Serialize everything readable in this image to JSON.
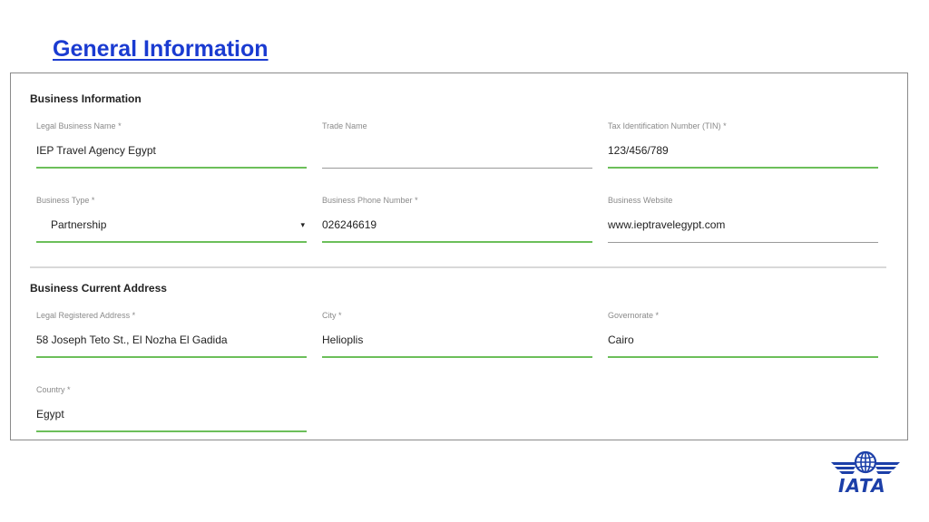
{
  "page": {
    "title": "General Information"
  },
  "business_info": {
    "title": "Business Information",
    "fields": {
      "legal_name": {
        "label": "Legal Business Name",
        "required": "*",
        "value": "IEP Travel Agency Egypt"
      },
      "trade_name": {
        "label": "Trade Name",
        "value": ""
      },
      "tin": {
        "label": "Tax Identification Number (TIN)",
        "required": "*",
        "value": "123/456/789"
      },
      "business_type": {
        "label": "Business Type",
        "required": "*",
        "value": "Partnership",
        "caret": "▾"
      },
      "phone": {
        "label": "Business Phone Number",
        "required": "*",
        "value": "026246619"
      },
      "website": {
        "label": "Business Website",
        "value": "www.ieptravelegypt.com"
      }
    }
  },
  "address": {
    "title": "Business Current Address",
    "fields": {
      "legal_address": {
        "label": "Legal Registered Address",
        "required": "*",
        "value": "58 Joseph Teto St., El Nozha El Gadida"
      },
      "city": {
        "label": "City",
        "required": "*",
        "value": "Helioplis"
      },
      "governorate": {
        "label": "Governorate",
        "required": "*",
        "value": "Cairo"
      },
      "country": {
        "label": "Country",
        "required": "*",
        "value": "Egypt"
      }
    }
  },
  "logo": {
    "text": "IATA",
    "icon": "iata-globe-wings-icon",
    "color": "#1c3fa8"
  },
  "colors": {
    "title": "#1a3bd1",
    "active_underline": "#6cbf5a",
    "inactive_underline": "#9a9a9a"
  }
}
